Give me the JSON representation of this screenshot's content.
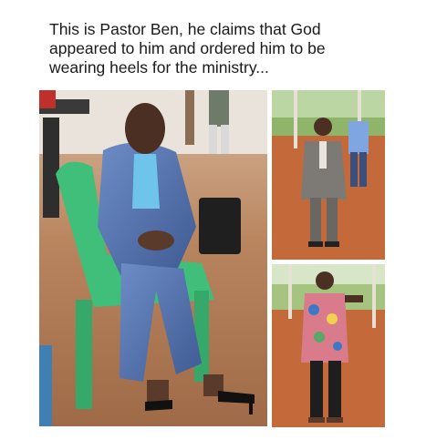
{
  "post": {
    "caption": "This is Pastor Ben, he claims that God\nappeared to him and ordered him to be\nwearing heels for the ministry..."
  },
  "photos": [
    {
      "subject": "man in blue suit and high heels seated on green plastic chair"
    },
    {
      "subject": "man in grey suit walking on dirt path"
    },
    {
      "subject": "man in floral shirt walking on dirt path"
    }
  ],
  "colors": {
    "suit_blue": "#5a78b4",
    "chair_green": "#3fbf7a",
    "soil": "#c46a3a",
    "grey_suit": "#7d7a76"
  }
}
